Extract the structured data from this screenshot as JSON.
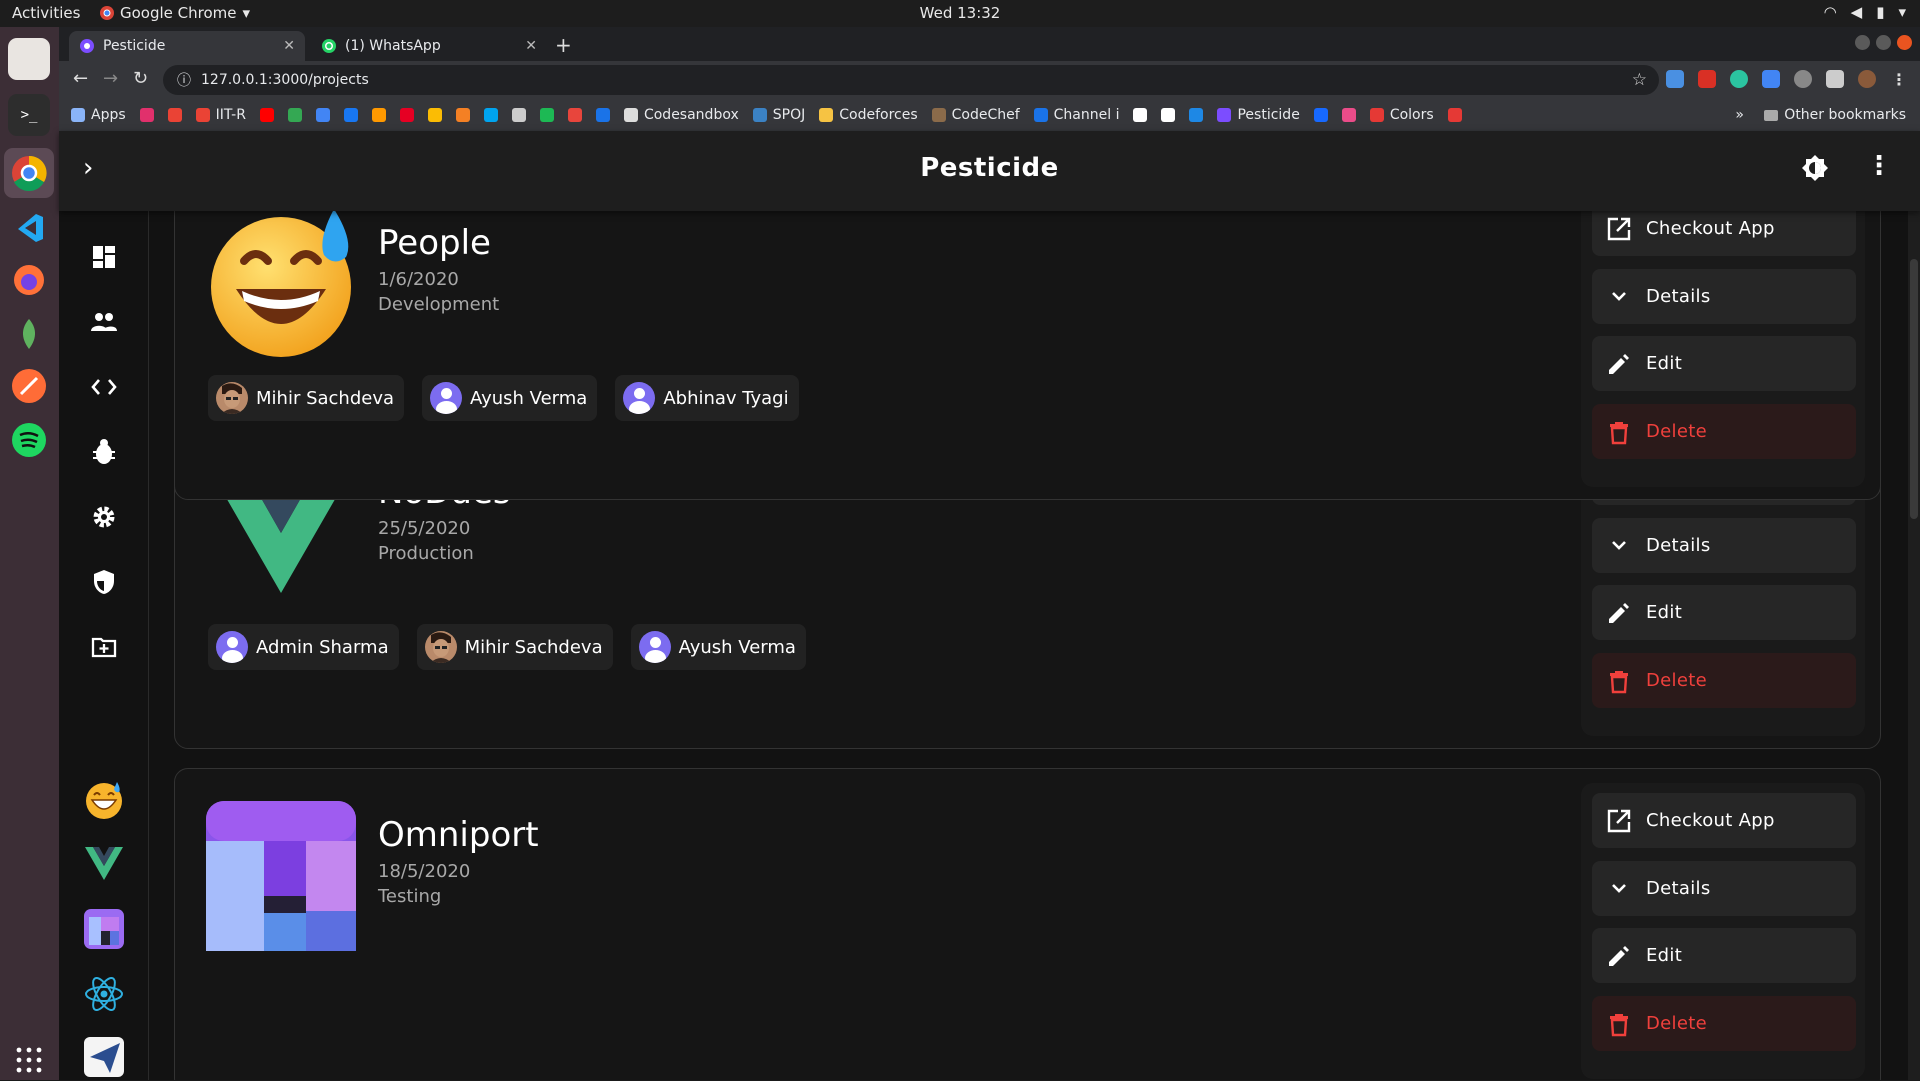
{
  "system": {
    "activities": "Activities",
    "app_name": "Google Chrome",
    "clock": "Wed 13:32"
  },
  "browser": {
    "tabs": [
      {
        "label": "Pesticide",
        "active": true
      },
      {
        "label": "(1) WhatsApp",
        "active": false
      }
    ],
    "url": "127.0.0.1:3000/projects",
    "bookmarks": [
      {
        "label": "Apps",
        "color": "#8ab4f8"
      },
      {
        "label": "",
        "color": "#e1306c"
      },
      {
        "label": "",
        "color": "#ea4335"
      },
      {
        "label": "IIT-R",
        "color": "#ea4335"
      },
      {
        "label": "",
        "color": "#ff0000"
      },
      {
        "label": "",
        "color": "#34a853"
      },
      {
        "label": "",
        "color": "#4285f4"
      },
      {
        "label": "",
        "color": "#1877f2"
      },
      {
        "label": "",
        "color": "#ff9900"
      },
      {
        "label": "",
        "color": "#e60023"
      },
      {
        "label": "",
        "color": "#fbbc04"
      },
      {
        "label": "",
        "color": "#f48024"
      },
      {
        "label": "",
        "color": "#00a4ef"
      },
      {
        "label": "",
        "color": "#cccccc"
      },
      {
        "label": "",
        "color": "#1db954"
      },
      {
        "label": "",
        "color": "#e8453c"
      },
      {
        "label": "",
        "color": "#1a73e8"
      },
      {
        "label": "Codesandbox",
        "color": "#dddddd"
      },
      {
        "label": "SPOJ",
        "color": "#3b82c4"
      },
      {
        "label": "Codeforces",
        "color": "#f6c343"
      },
      {
        "label": "CodeChef",
        "color": "#8b6b4a"
      },
      {
        "label": "Channel i",
        "color": "#1a73e8"
      },
      {
        "label": "",
        "color": "#ffffff"
      },
      {
        "label": "",
        "color": "#ffffff"
      },
      {
        "label": "",
        "color": "#1e88e5"
      },
      {
        "label": "Pesticide",
        "color": "#7c4dff"
      },
      {
        "label": "",
        "color": "#1769ff"
      },
      {
        "label": "",
        "color": "#ea4c89"
      },
      {
        "label": "Colors",
        "color": "#e53935"
      },
      {
        "label": "",
        "color": "#e53935"
      }
    ],
    "other_bookmarks": "Other bookmarks"
  },
  "app": {
    "title": "Pesticide"
  },
  "projects": [
    {
      "name": "People",
      "date": "1/6/2020",
      "stage": "Development",
      "logo": "grinning-sweat-emoji",
      "members": [
        {
          "name": "Mihir Sachdeva",
          "photo": true
        },
        {
          "name": "Ayush Verma",
          "photo": false
        },
        {
          "name": "Abhinav Tyagi",
          "photo": false
        }
      ]
    },
    {
      "name": "NoDues",
      "date": "25/5/2020",
      "stage": "Production",
      "logo": "vue-logo",
      "members": [
        {
          "name": "Admin Sharma",
          "photo": false
        },
        {
          "name": "Mihir Sachdeva",
          "photo": true
        },
        {
          "name": "Ayush Verma",
          "photo": false
        }
      ]
    },
    {
      "name": "Omniport",
      "date": "18/5/2020",
      "stage": "Testing",
      "logo": "omniport-logo",
      "members": []
    }
  ],
  "actions": {
    "checkout": "Checkout App",
    "details": "Details",
    "edit": "Edit",
    "delete": "Delete"
  },
  "colors": {
    "delete": "#f0403c",
    "avatar": "#7c6cf0",
    "vue_green": "#41b883",
    "vue_dark": "#34495e"
  }
}
